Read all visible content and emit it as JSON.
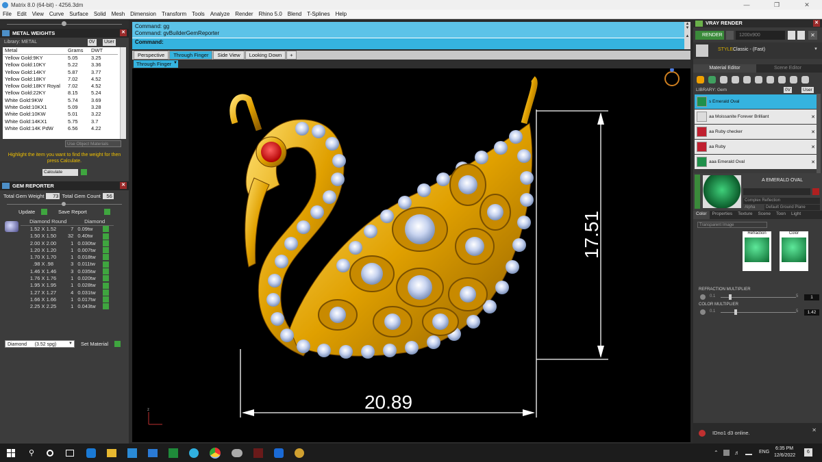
{
  "window": {
    "title": "Matrix 8.0 (64-bit) - 4256.3dm"
  },
  "menu": [
    "File",
    "Edit",
    "View",
    "Curve",
    "Surface",
    "Solid",
    "Mesh",
    "Dimension",
    "Transform",
    "Tools",
    "Analyze",
    "Render",
    "Rhino 5.0",
    "Blend",
    "T-Splines",
    "Help"
  ],
  "metal_weights": {
    "title": "METAL WEIGHTS",
    "library_label": "Library: METAL",
    "btn_0v": "0V",
    "btn_user": "User",
    "columns": [
      "Metal",
      "Grams",
      "DWT"
    ],
    "rows": [
      [
        "Yellow Gold:9KY",
        "5.05",
        "3.25"
      ],
      [
        "Yellow Gold:10KY",
        "5.22",
        "3.36"
      ],
      [
        "Yellow Gold:14KY",
        "5.87",
        "3.77"
      ],
      [
        "Yellow Gold:18KY",
        "7.02",
        "4.52"
      ],
      [
        "Yellow Gold:18KY Royal",
        "7.02",
        "4.52"
      ],
      [
        "Yellow Gold:22KY",
        "8.15",
        "5.24"
      ],
      [
        "White Gold:9KW",
        "5.74",
        "3.69"
      ],
      [
        "White Gold:10KX1",
        "5.09",
        "3.28"
      ],
      [
        "White Gold:10KW",
        "5.01",
        "3.22"
      ],
      [
        "White Gold:14KX1",
        "5.75",
        "3.7"
      ],
      [
        "White Gold:14K PdW",
        "6.56",
        "4.22"
      ]
    ],
    "use_object_materials": "Use Object Materials",
    "hint": "Highlight the item you want to find the weight for then press Calculate.",
    "calculate": "Calculate"
  },
  "gem_reporter": {
    "title": "GEM REPORTER",
    "total_weight_label": "Total Gem Weight",
    "total_weight": "73",
    "total_count_label": "Total Gem Count",
    "total_count": "56",
    "update": "Update",
    "save_report": "Save Report",
    "col_size": "Diamond Round",
    "col_type": "Diamond",
    "rows": [
      [
        "1.52 X 1.52",
        "7",
        "0.09tw"
      ],
      [
        "1.50 X 1.50",
        "32",
        "0.40tw"
      ],
      [
        "2.00 X 2.00",
        "1",
        "0.030tw"
      ],
      [
        "1.20 X 1.20",
        "1",
        "0.007tw"
      ],
      [
        "1.70 X 1.70",
        "1",
        "0.018tw"
      ],
      [
        ".98 X .98",
        "3",
        "0.011tw"
      ],
      [
        "1.46 X 1.46",
        "3",
        "0.035tw"
      ],
      [
        "1.76 X 1.76",
        "1",
        "0.020tw"
      ],
      [
        "1.95 X 1.95",
        "1",
        "0.028tw"
      ],
      [
        "1.27 X 1.27",
        "4",
        "0.031tw"
      ],
      [
        "1.66 X 1.66",
        "1",
        "0.017tw"
      ],
      [
        "2.25 X 2.25",
        "1",
        "0.043tw"
      ]
    ],
    "material_select": "Diamond      (3.52 spg)",
    "set_material": "Set Material"
  },
  "command": {
    "history": [
      "Command: gg",
      "Command: gvBuilderGemReporter"
    ],
    "prompt": "Command:"
  },
  "viewport_tabs": [
    "Perspective",
    "Through Finger",
    "Side View",
    "Looking Down"
  ],
  "active_view": "Through Finger",
  "dimensions": {
    "width": "20.89",
    "height": "17.51"
  },
  "vray": {
    "title": "VRAY RENDER",
    "render_btn": "RENDER",
    "resolution": "1200x900",
    "style_label": "STYLE:",
    "style_value": "Classic - (Fast)",
    "tabs": [
      "Material Editor",
      "Scene Editor"
    ],
    "library_label": "LIBRARY: Gem",
    "materials": [
      {
        "name": "s Emerald Oval",
        "color": "#1f8f4a",
        "selected": true
      },
      {
        "name": "aa Moissanite Forever Brilliant",
        "color": "#dcdcdc",
        "selected": false
      },
      {
        "name": "aa Ruby checker",
        "color": "#c02030",
        "selected": false
      },
      {
        "name": "aa Ruby",
        "color": "#c02030",
        "selected": false
      },
      {
        "name": "aaa Emerald Oval",
        "color": "#1f8f4a",
        "selected": false
      }
    ],
    "preview_name": "A EMERALD OVAL",
    "reflection": "Complex Reflection",
    "alpha": "Alpha",
    "ground": "Default Ground Plane",
    "prop_tabs": [
      "Color",
      "Properties",
      "Texture",
      "Scene",
      "Toon",
      "Light"
    ],
    "transparent": "Transparent Image",
    "refraction_label": "Refraction",
    "color_label": "Color",
    "refraction_mult_label": "REFRACTION MULTIPLIER",
    "refraction_min": "0.1",
    "refraction_max": "5",
    "refraction_value": "1",
    "color_mult_label": "COLOR MULTIPLIER",
    "color_min": "0.1",
    "color_max": "5",
    "color_value": "1.42"
  },
  "notification": "IDno1 d3 online.",
  "taskbar": {
    "lang": "ENG",
    "time": "6:35 PM",
    "date": "12/6/2022",
    "notif_count": "6"
  }
}
